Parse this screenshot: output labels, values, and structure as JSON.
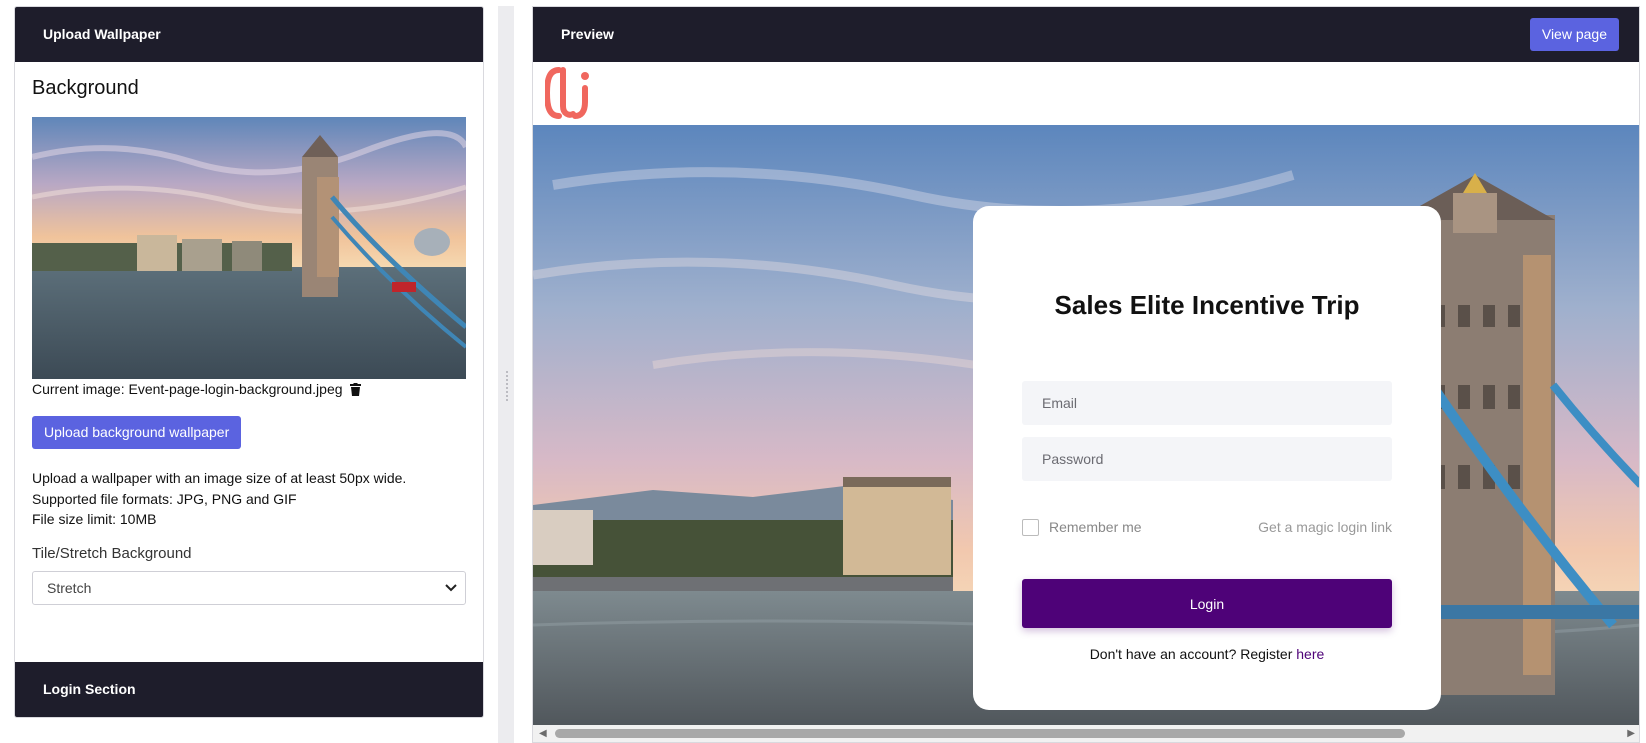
{
  "left_panel": {
    "header_title": "Upload Wallpaper",
    "section_title": "Background",
    "current_image_label": "Current image: Event-page-login-background.jpeg",
    "upload_button": "Upload background wallpaper",
    "help_lines": [
      "Upload a wallpaper with an image size of at least 50px wide.",
      "Supported file formats: JPG, PNG and GIF",
      "File size limit: 10MB"
    ],
    "tile_label": "Tile/Stretch Background",
    "tile_value": "Stretch",
    "login_section_title": "Login Section"
  },
  "preview": {
    "header_title": "Preview",
    "view_page_button": "View page",
    "card": {
      "title": "Sales Elite Incentive Trip",
      "email_placeholder": "Email",
      "password_placeholder": "Password",
      "remember_me": "Remember me",
      "magic_link": "Get a magic login link",
      "login_button": "Login",
      "register_text": "Don't have an account? Register",
      "register_link": "here"
    }
  },
  "icons": [
    "trash-icon",
    "chevron-down-icon",
    "logo-icon",
    "scroll-left-icon",
    "scroll-right-icon"
  ],
  "colors": {
    "header_dark": "#1e1d2b",
    "accent_blue": "#5b63e0",
    "login_purple": "#4e0278",
    "logo_coral": "#f0675e"
  }
}
